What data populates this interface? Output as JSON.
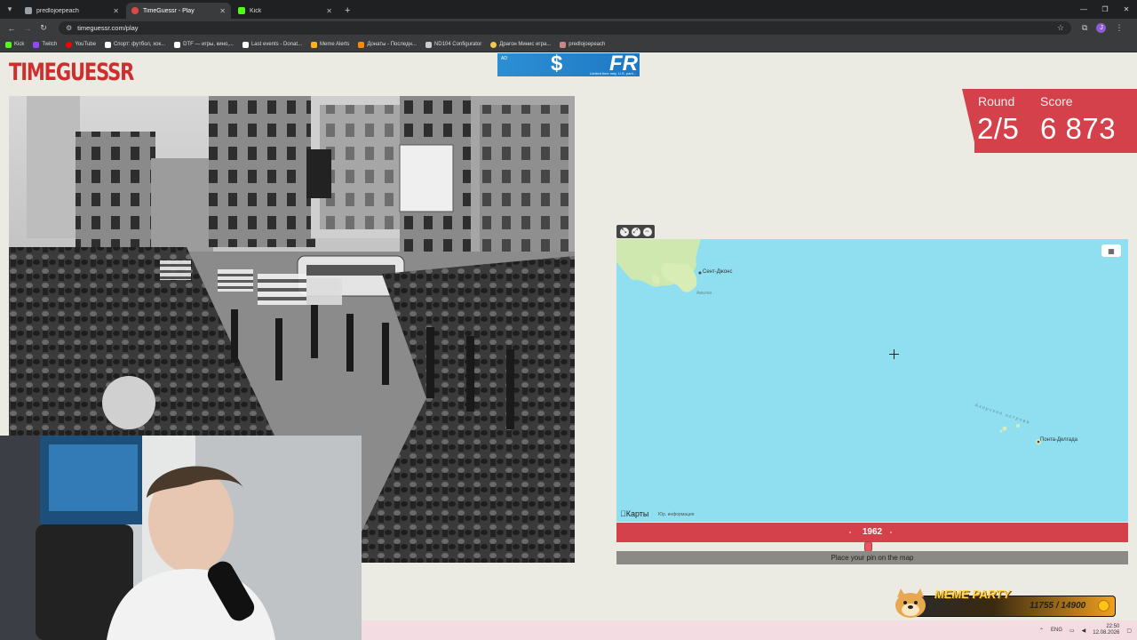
{
  "browser": {
    "tabs": [
      {
        "title": "predlojoepeach",
        "active": false,
        "color": "#9aa0a6"
      },
      {
        "title": "TimeGuessr - Play",
        "active": true,
        "color": "#e04848"
      },
      {
        "title": "Kick",
        "active": false,
        "color": "#53fc18"
      }
    ],
    "url": "timeguessr.com/play",
    "bookmarks": [
      {
        "label": "Kick",
        "color": "#53fc18"
      },
      {
        "label": "Twitch",
        "color": "#9146ff"
      },
      {
        "label": "YouTube",
        "color": "#ff0000"
      },
      {
        "label": "Спорт: футбол, хок...",
        "color": "#ffffff"
      },
      {
        "label": "DTF — игры, кино,...",
        "color": "#ffffff"
      },
      {
        "label": "Last events - Donat...",
        "color": "#ffffff"
      },
      {
        "label": "Meme Alerts",
        "color": "#ffb020"
      },
      {
        "label": "Донаты - Последн...",
        "color": "#ff8a00"
      },
      {
        "label": "ND104 Configurator",
        "color": "#cccccc"
      },
      {
        "label": "Драгон Минис игра...",
        "color": "#f2c94c"
      },
      {
        "label": "predlojoepeach",
        "color": "#c88"
      }
    ]
  },
  "page": {
    "logo": "TIMEGUESSR",
    "ad": {
      "tag": "AD",
      "headline": "FR",
      "dollar": "$",
      "fine": "Limited time only. U.S. parti..."
    }
  },
  "score": {
    "round_label": "Round",
    "round_value": "2/5",
    "score_label": "Score",
    "score_value": "6 873"
  },
  "map": {
    "labels": {
      "st_johns": "Сент-Джонс",
      "st_johns_sub": "Авалон",
      "azores": "Азорские острова",
      "ponta_delgada": "Понта-Делгада"
    },
    "brand": "Карты",
    "legal": "Юр. информация"
  },
  "year": {
    "value": "1962"
  },
  "place_text": "Place your pin on the map",
  "overlay": {
    "meme_title": "MEME PARTY",
    "meme_count": "11755 / 14900"
  },
  "taskbar": {
    "lang": "ENG",
    "time": "22:50",
    "date": "12.08.2026"
  }
}
